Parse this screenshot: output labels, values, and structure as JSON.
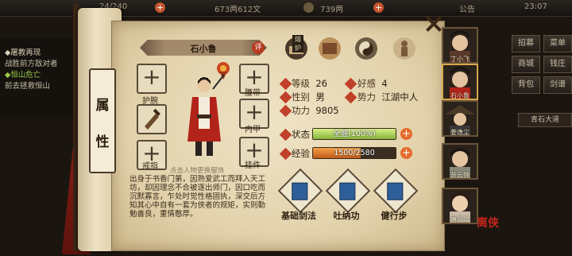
{
  "topbar": {
    "energy": "24/240",
    "money": "673两612文",
    "ingots": "739两",
    "announce": "公告",
    "clock": "23:07"
  },
  "quests": [
    {
      "title": "◆屠教再现",
      "body": "战胜前方敌对者"
    },
    {
      "title": "◆恒山危亡",
      "body": "前去拯救恒山"
    }
  ],
  "panel": {
    "tab_chars": [
      "属",
      "性"
    ]
  },
  "character": {
    "name": "石小鲁",
    "eval_badge": "评",
    "change_hint": "点击人物更换服饰",
    "equip_slots": [
      {
        "id": "bracer",
        "label": "护腕",
        "filled": false
      },
      {
        "id": "weapon",
        "label": "",
        "filled": true
      },
      {
        "id": "ring",
        "label": "戒指",
        "filled": false
      },
      {
        "id": "belt",
        "label": "腰带",
        "filled": false
      },
      {
        "id": "armor",
        "label": "内甲",
        "filled": false
      },
      {
        "id": "pendant",
        "label": "挂件",
        "filled": false
      }
    ],
    "top_icons": [
      {
        "name": "food-icon",
        "badge": "熔炉"
      },
      {
        "name": "map-icon",
        "badge": ""
      },
      {
        "name": "taiji-icon",
        "badge": ""
      },
      {
        "name": "meridian-icon",
        "badge": ""
      }
    ],
    "stats": {
      "level_label": "等级",
      "level": "26",
      "favor_label": "好感",
      "favor": "4",
      "gender_label": "性别",
      "gender": "男",
      "faction_label": "势力",
      "faction": "江湖中人",
      "power_label": "功力",
      "power": "9805"
    },
    "status": {
      "label": "状态",
      "text": "全盛(100%)",
      "fraction": 1.0
    },
    "exp": {
      "label": "经验",
      "text": "1500/2580",
      "fraction": 0.58
    },
    "bio": "出身于书香门第，因熟爱武工而拜入天工坊，却因理念不合被逐出师门，因口吃而沉默寡言，乍处时觉性格固执，深交后方知其心中自有一套为侠者的规矩，实则勤勉善良，重情憨厚。",
    "skills": [
      {
        "name": "基础剑法"
      },
      {
        "name": "吐纳功"
      },
      {
        "name": "健行步"
      }
    ]
  },
  "party": [
    {
      "name": "丁小飞"
    },
    {
      "name": "石小鲁"
    },
    {
      "name": "姜逸尘"
    },
    {
      "name": "苏云锦"
    },
    {
      "name": "唐凤华"
    }
  ],
  "menu": [
    "招募",
    "菜单",
    "商城",
    "钱庄",
    "背包",
    "剑谱"
  ],
  "side_label": "青石大道",
  "seal_text": "离侠",
  "colors": {
    "parchment": "#e8dcbf",
    "accent": "#c0402a",
    "bar_fill": "#a6cf4f"
  }
}
